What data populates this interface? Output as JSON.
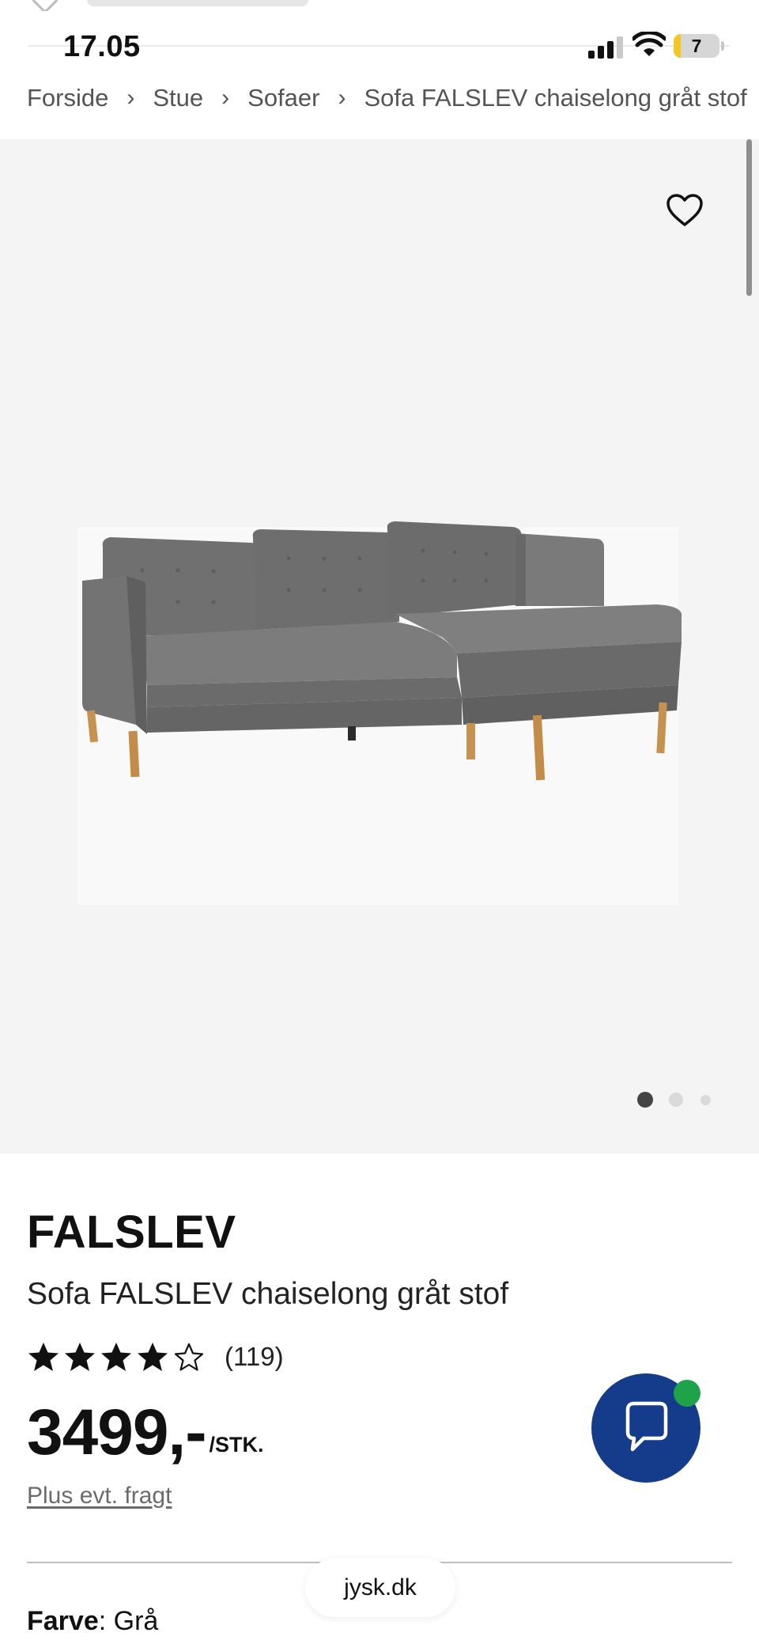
{
  "status_bar": {
    "time": "17.05",
    "battery": "7"
  },
  "breadcrumb": {
    "items": [
      "Forside",
      "Stue",
      "Sofaer",
      "Sofa FALSLEV chaiselong gråt stof"
    ],
    "separator": "›"
  },
  "gallery": {
    "image_alt": "Grey chaise longue sofa",
    "slide_count": 3,
    "active_slide": 1,
    "favorite_icon": "heart-outline-icon"
  },
  "product": {
    "brand": "FALSLEV",
    "name": "Sofa FALSLEV chaiselong gråt stof",
    "rating": {
      "value": 4,
      "max": 5,
      "count": "(119)"
    },
    "price": "3499,-",
    "unit": "/STK.",
    "freight_link": "Plus evt. fragt",
    "color_label": "Farve",
    "color_value": "Grå"
  },
  "chat": {
    "icon": "chat-bubble-icon",
    "status": "online"
  },
  "browser": {
    "url": "jysk.dk"
  },
  "colors": {
    "chat_blue": "#143c8a",
    "online_green": "#1ea24a",
    "gallery_bg": "#f4f4f4",
    "text": "#111111"
  }
}
